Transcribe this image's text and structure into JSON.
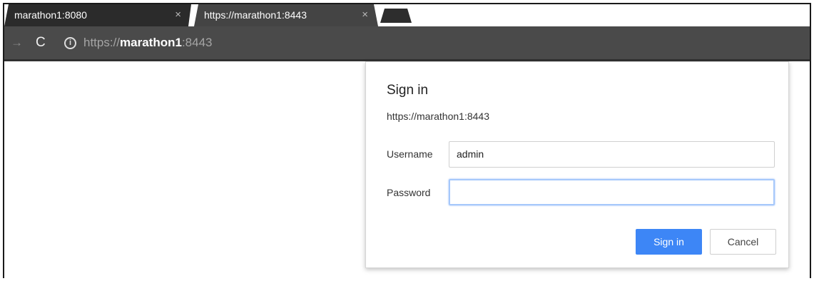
{
  "tabs": [
    {
      "title": "marathon1:8080",
      "close": "×"
    },
    {
      "title": "https://marathon1:8443",
      "close": "×"
    }
  ],
  "toolbar": {
    "forward_icon": "→",
    "reload_icon": "C",
    "info_icon": "i",
    "url_scheme": "https://",
    "url_host": "marathon1",
    "url_port": ":8443"
  },
  "dialog": {
    "title": "Sign in",
    "origin": "https://marathon1:8443",
    "username_label": "Username",
    "username_value": "admin",
    "password_label": "Password",
    "password_value": "",
    "signin_button": "Sign in",
    "cancel_button": "Cancel"
  },
  "colors": {
    "tab_active": "#444444",
    "toolbar": "#4a4a4a",
    "primary_button": "#3d86f6",
    "focus_ring": "#a6c8fb"
  }
}
